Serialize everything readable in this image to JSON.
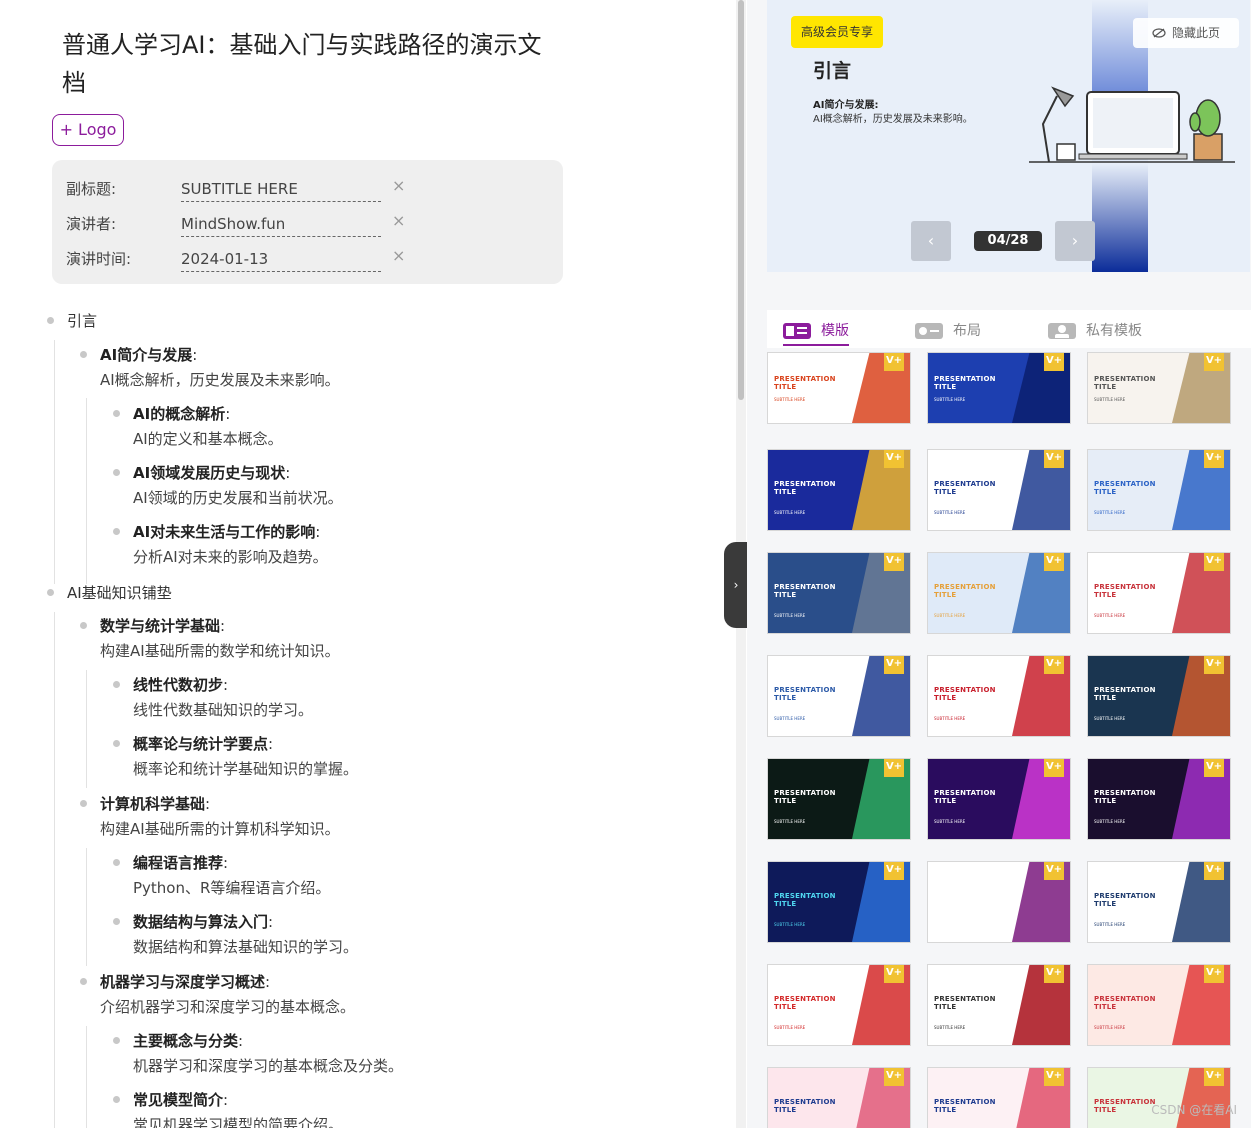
{
  "doc": {
    "title": "普通人学习AI：基础入门与实践路径的演示文档",
    "logo_button": "+ Logo",
    "meta": [
      {
        "label": "副标题:",
        "value": "SUBTITLE HERE"
      },
      {
        "label": "演讲者:",
        "value": "MindShow.fun"
      },
      {
        "label": "演讲时间:",
        "value": "2024-01-13"
      }
    ],
    "clear_glyph": "×"
  },
  "outline": {
    "n1": {
      "title": "引言"
    },
    "n1_1": {
      "title": "AI简介与发展",
      "colon": ":",
      "desc": "AI概念解析，历史发展及未来影响。"
    },
    "n1_1_1": {
      "title": "AI的概念解析",
      "colon": ":",
      "desc": "AI的定义和基本概念。"
    },
    "n1_1_2": {
      "title": "AI领域发展历史与现状",
      "colon": ":",
      "desc": "AI领域的历史发展和当前状况。"
    },
    "n1_1_3": {
      "title": "AI对未来生活与工作的影响",
      "colon": ":",
      "desc": "分析AI对未来的影响及趋势。"
    },
    "n2": {
      "title": "AI基础知识铺垫"
    },
    "n2_1": {
      "title": "数学与统计学基础",
      "colon": ":",
      "desc": "构建AI基础所需的数学和统计知识。"
    },
    "n2_1_1": {
      "title": "线性代数初步",
      "colon": ":",
      "desc": "线性代数基础知识的学习。"
    },
    "n2_1_2": {
      "title": "概率论与统计学要点",
      "colon": ":",
      "desc": "概率论和统计学基础知识的掌握。"
    },
    "n2_2": {
      "title": "计算机科学基础",
      "colon": ":",
      "desc": "构建AI基础所需的计算机科学知识。"
    },
    "n2_2_1": {
      "title": "编程语言推荐",
      "colon": ":",
      "desc": "Python、R等编程语言介绍。"
    },
    "n2_2_2": {
      "title": "数据结构与算法入门",
      "colon": ":",
      "desc": "数据结构和算法基础知识的学习。"
    },
    "n2_3": {
      "title": "机器学习与深度学习概述",
      "colon": ":",
      "desc": "介绍机器学习和深度学习的基本概念。"
    },
    "n2_3_1": {
      "title": "主要概念与分类",
      "colon": ":",
      "desc": "机器学习和深度学习的基本概念及分类。"
    },
    "n2_3_2": {
      "title": "常见模型简介",
      "colon": ":",
      "desc": "常见机器学习模型的简要介绍。"
    }
  },
  "collapse_glyph": "›",
  "preview": {
    "vip_badge": "高级会员专享",
    "hide_page": "隐藏此页",
    "heading": "引言",
    "sub_title": "AI简介与发展:",
    "sub_text": "AI概念解析，历史发展及未来影响。",
    "page_indicator": "04/28",
    "prev_glyph": "‹",
    "next_glyph": "›"
  },
  "tabs": [
    {
      "label": "模版",
      "active": true
    },
    {
      "label": "布局",
      "active": false
    },
    {
      "label": "私有模板",
      "active": false
    }
  ],
  "templates": [
    {
      "title": "PRESENTATION TITLE",
      "sub": "SUBTITLE HERE",
      "bg": "#ffffff",
      "accent": "#d9441e",
      "text": "#d9441e",
      "vip": true
    },
    {
      "title": "PRESENTATION TITLE",
      "sub": "SUBTITLE HERE",
      "bg": "#1d3fb0",
      "accent": "#0a1f6e",
      "text": "#ffffff",
      "vip": true
    },
    {
      "title": "PRESENTATION TITLE",
      "sub": "SUBTITLE HERE",
      "bg": "#f7f3ee",
      "accent": "#b59a6b",
      "text": "#555555",
      "vip": true
    },
    {
      "title": "PRESENTATION TITLE",
      "sub": "SUBTITLE HERE",
      "bg": "#1a2a9c",
      "accent": "#f0b52c",
      "text": "#ffffff",
      "vip": true
    },
    {
      "title": "PRESENTATION TITLE",
      "sub": "SUBTITLE HERE",
      "bg": "#ffffff",
      "accent": "#1f3c8f",
      "text": "#1f3c8f",
      "vip": true
    },
    {
      "title": "PRESENTATION TITLE",
      "sub": "SUBTITLE HERE",
      "bg": "#e6edf7",
      "accent": "#2c63c6",
      "text": "#2c63c6",
      "vip": true
    },
    {
      "title": "PRESENTATION TITLE",
      "sub": "SUBTITLE HERE",
      "bg": "#2a4e8a",
      "accent": "#6b7d95",
      "text": "#ffffff",
      "vip": true
    },
    {
      "title": "PRESENTATION TITLE",
      "sub": "SUBTITLE HERE",
      "bg": "#dfeaf8",
      "accent": "#3a6fb8",
      "text": "#e5a03a",
      "vip": true
    },
    {
      "title": "PRESENTATION TITLE",
      "sub": "SUBTITLE HERE",
      "bg": "#ffffff",
      "accent": "#c8333b",
      "text": "#c8333b",
      "vip": true
    },
    {
      "title": "PRESENTATION TITLE",
      "sub": "SUBTITLE HERE",
      "bg": "#ffffff",
      "accent": "#1f3c8f",
      "text": "#2c5aa8",
      "vip": true
    },
    {
      "title": "PRESENTATION TITLE",
      "sub": "SUBTITLE HERE",
      "bg": "#ffffff",
      "accent": "#c8202d",
      "text": "#c8202d",
      "vip": true
    },
    {
      "title": "PRESENTATION TITLE",
      "sub": "SUBTITLE HERE",
      "bg": "#1a3550",
      "accent": "#d05a2c",
      "text": "#ffffff",
      "vip": true
    },
    {
      "title": "PRESENTATION TITLE",
      "sub": "SUBTITLE HERE",
      "bg": "#0c1a16",
      "accent": "#2fae6a",
      "text": "#ffffff",
      "vip": true
    },
    {
      "title": "PRESENTATION TITLE",
      "sub": "SUBTITLE HERE",
      "bg": "#2a0c5e",
      "accent": "#d43ad8",
      "text": "#ffffff",
      "vip": true
    },
    {
      "title": "PRESENTATION TITLE",
      "sub": "SUBTITLE HERE",
      "bg": "#1a0e2e",
      "accent": "#a22fc8",
      "text": "#ffffff",
      "vip": true
    },
    {
      "title": "PRESENTATION TITLE",
      "sub": "SUBTITLE HERE",
      "bg": "#0e1a5a",
      "accent": "#2a6fd8",
      "text": "#4fd6f0",
      "vip": true
    },
    {
      "title": "PRESENTATION TITLE",
      "sub": "SUBTITLE HERE",
      "bg": "#ffffff",
      "accent": "#7a1a7e",
      "text": "#ffffff",
      "vip": true
    },
    {
      "title": "PRESENTATION TITLE",
      "sub": "SUBTITLE HERE",
      "bg": "#ffffff",
      "accent": "#1f3c6e",
      "text": "#1f3c6e",
      "vip": true
    },
    {
      "title": "PRESENTATION TITLE",
      "sub": "SUBTITLE HERE",
      "bg": "#ffffff",
      "accent": "#d32a2a",
      "text": "#d32a2a",
      "vip": true
    },
    {
      "title": "PRESENTATION TITLE",
      "sub": "SUBTITLE HERE",
      "bg": "#ffffff",
      "accent": "#a80f1a",
      "text": "#333333",
      "vip": true
    },
    {
      "title": "PRESENTATION TITLE",
      "sub": "SUBTITLE HERE",
      "bg": "#fde9e4",
      "accent": "#e23b3b",
      "text": "#c8333b",
      "vip": true
    },
    {
      "title": "PRESENTATION TITLE",
      "sub": "SUBTITLE HERE",
      "bg": "#fde6ec",
      "accent": "#e05a7a",
      "text": "#1f3c8f",
      "vip": true
    },
    {
      "title": "PRESENTATION TITLE",
      "sub": "SUBTITLE HERE",
      "bg": "#fdf1f4",
      "accent": "#e0506a",
      "text": "#1f3c8f",
      "vip": true
    },
    {
      "title": "PRESENTATION TITLE",
      "sub": "SUBTITLE HERE",
      "bg": "#eaf6e4",
      "accent": "#e34a3a",
      "text": "#c8333b",
      "vip": true
    }
  ],
  "vip_tag": "V+",
  "watermark": "CSDN @在看AI"
}
